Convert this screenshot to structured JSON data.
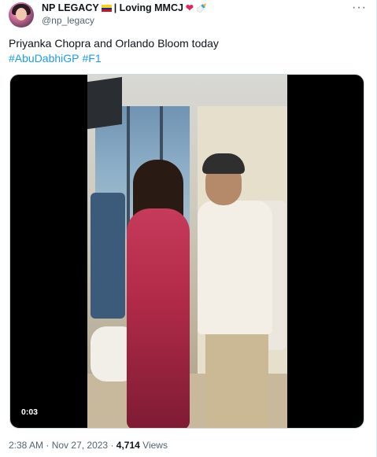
{
  "tweet": {
    "author_name": "NP LEGACY",
    "name_suffix": "| Loving MMCJ",
    "handle": "@np_legacy",
    "text": "Priyanka Chopra and Orlando Bloom today",
    "hashtags": [
      "#AbuDabhiGP",
      "#F1"
    ],
    "video_duration": "0:03",
    "time": "2:38 AM",
    "separator": "·",
    "date": "Nov 27, 2023",
    "views_count": "4,714",
    "views_label": "Views",
    "more_icon": "more-horizontal-icon"
  },
  "colors": {
    "hashtag": "#1d9bf0",
    "secondary_text": "#536471",
    "heart": "#e0245e",
    "flag_stripes": [
      "#fcd116",
      "#003893",
      "#ce1126"
    ]
  }
}
